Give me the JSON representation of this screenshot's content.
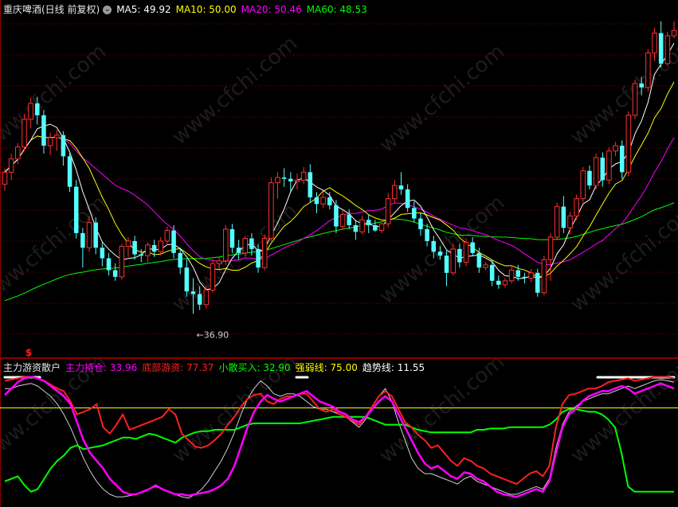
{
  "price_panel": {
    "title": "重庆啤酒(日线 前复权)",
    "dropdown_icon": "chevron-down-icon",
    "indicators": [
      {
        "label": "MA5: 49.92",
        "color": "#ffffff"
      },
      {
        "label": "MA10: 50.00",
        "color": "#ffff00"
      },
      {
        "label": "MA20: 50.46",
        "color": "#ff00ff"
      },
      {
        "label": "MA60: 48.53",
        "color": "#00ff00"
      }
    ],
    "low_marker": "36.90",
    "signal_marker": "$"
  },
  "indicator_panel": {
    "title": "主力游资散户",
    "indicators": [
      {
        "label": "主力持仓: 33.96",
        "color": "#ff00ff"
      },
      {
        "label": "底部游资: 77.37",
        "color": "#ff2020"
      },
      {
        "label": "小散买入: 32.90",
        "color": "#00ff00"
      },
      {
        "label": "强弱线: 75.00",
        "color": "#ffff00"
      },
      {
        "label": "趋势线: 11.55",
        "color": "#ffffff"
      }
    ]
  },
  "watermark": "www.cfchi.com",
  "colors": {
    "up": "#ff3030",
    "down": "#54ffff",
    "grid": "#8b0000",
    "background": "#000000"
  },
  "chart_data": [
    {
      "type": "candlestick",
      "name": "price",
      "ylim": [
        35,
        60
      ],
      "candles": [
        [
          47.3,
          48.5,
          46.8,
          48.2
        ],
        [
          48.2,
          49.6,
          47.6,
          49.2
        ],
        [
          49.2,
          50.4,
          48.8,
          50.1
        ],
        [
          50.1,
          52.6,
          49.8,
          52.2
        ],
        [
          52.2,
          53.8,
          51.5,
          53.4
        ],
        [
          53.4,
          53.9,
          51.8,
          52.5
        ],
        [
          52.5,
          52.9,
          49.6,
          50.2
        ],
        [
          50.2,
          51.2,
          49.5,
          50.8
        ],
        [
          50.8,
          51.4,
          49.8,
          51.0
        ],
        [
          51.0,
          51.3,
          48.7,
          49.4
        ],
        [
          49.4,
          49.8,
          46.7,
          47.1
        ],
        [
          47.1,
          47.6,
          43.2,
          43.6
        ],
        [
          43.6,
          44.0,
          41.0,
          42.5
        ],
        [
          42.5,
          44.9,
          42.2,
          44.4
        ],
        [
          44.4,
          44.8,
          42.0,
          42.5
        ],
        [
          42.5,
          42.9,
          41.1,
          41.7
        ],
        [
          41.7,
          42.1,
          40.4,
          40.8
        ],
        [
          40.8,
          41.3,
          40.0,
          40.3
        ],
        [
          40.3,
          42.8,
          40.1,
          42.6
        ],
        [
          42.6,
          43.3,
          41.8,
          43.0
        ],
        [
          43.0,
          43.4,
          41.6,
          42.0
        ],
        [
          42.0,
          42.4,
          41.4,
          41.9
        ],
        [
          41.9,
          42.9,
          41.4,
          42.7
        ],
        [
          42.7,
          43.1,
          41.8,
          42.2
        ],
        [
          42.2,
          43.3,
          41.9,
          43.0
        ],
        [
          43.0,
          44.1,
          42.7,
          43.8
        ],
        [
          43.8,
          44.2,
          41.7,
          42.1
        ],
        [
          42.1,
          42.5,
          40.5,
          41.0
        ],
        [
          41.0,
          41.6,
          38.8,
          39.2
        ],
        [
          39.2,
          40.2,
          37.5,
          39.0
        ],
        [
          39.0,
          39.6,
          37.8,
          38.2
        ],
        [
          38.2,
          39.6,
          37.9,
          39.3
        ],
        [
          39.3,
          41.6,
          39.1,
          41.3
        ],
        [
          41.3,
          41.8,
          40.9,
          41.5
        ],
        [
          41.5,
          44.2,
          41.2,
          43.9
        ],
        [
          43.9,
          44.3,
          42.1,
          42.5
        ],
        [
          42.5,
          43.1,
          41.6,
          42.1
        ],
        [
          42.1,
          43.4,
          41.8,
          43.2
        ],
        [
          43.2,
          43.6,
          41.9,
          42.4
        ],
        [
          42.4,
          42.8,
          40.6,
          41.0
        ],
        [
          41.0,
          43.5,
          40.8,
          43.2
        ],
        [
          43.2,
          47.8,
          43.0,
          47.4
        ],
        [
          47.4,
          48.2,
          46.2,
          47.8
        ],
        [
          47.8,
          48.5,
          47.1,
          47.7
        ],
        [
          47.7,
          48.2,
          46.7,
          47.5
        ],
        [
          47.5,
          48.1,
          46.9,
          47.6
        ],
        [
          47.6,
          48.6,
          47.3,
          48.2
        ],
        [
          48.2,
          48.8,
          45.9,
          46.3
        ],
        [
          46.3,
          46.7,
          45.1,
          45.8
        ],
        [
          45.8,
          46.7,
          45.5,
          46.3
        ],
        [
          46.3,
          46.7,
          45.4,
          45.7
        ],
        [
          45.7,
          46.1,
          43.6,
          44.1
        ],
        [
          44.1,
          45.3,
          43.9,
          45.0
        ],
        [
          45.0,
          45.4,
          43.9,
          44.2
        ],
        [
          44.2,
          44.6,
          43.1,
          43.7
        ],
        [
          43.7,
          44.9,
          43.5,
          44.6
        ],
        [
          44.6,
          45.0,
          43.6,
          44.2
        ],
        [
          44.2,
          44.6,
          43.7,
          43.8
        ],
        [
          43.8,
          44.5,
          43.6,
          44.3
        ],
        [
          44.3,
          46.6,
          44.0,
          46.2
        ],
        [
          46.2,
          47.6,
          45.9,
          47.2
        ],
        [
          47.2,
          48.2,
          46.5,
          46.9
        ],
        [
          46.9,
          47.3,
          45.2,
          45.5
        ],
        [
          45.5,
          46.0,
          44.4,
          44.7
        ],
        [
          44.7,
          45.1,
          43.4,
          43.9
        ],
        [
          43.9,
          44.3,
          42.6,
          43.0
        ],
        [
          43.0,
          43.4,
          41.7,
          42.2
        ],
        [
          42.2,
          42.6,
          41.6,
          41.9
        ],
        [
          41.9,
          42.3,
          39.6,
          40.6
        ],
        [
          40.6,
          42.8,
          40.4,
          42.4
        ],
        [
          42.4,
          42.8,
          41.0,
          41.4
        ],
        [
          41.4,
          43.2,
          41.1,
          42.9
        ],
        [
          42.9,
          43.3,
          41.9,
          42.1
        ],
        [
          42.1,
          42.5,
          40.6,
          41.0
        ],
        [
          41.0,
          41.4,
          40.8,
          41.2
        ],
        [
          41.2,
          41.6,
          39.6,
          40.0
        ],
        [
          40.0,
          40.4,
          39.4,
          39.7
        ],
        [
          39.7,
          40.2,
          39.5,
          40.0
        ],
        [
          40.0,
          41.2,
          39.8,
          40.8
        ],
        [
          40.8,
          41.2,
          40.0,
          40.3
        ],
        [
          40.3,
          40.6,
          39.8,
          40.2
        ],
        [
          40.2,
          40.9,
          39.9,
          40.6
        ],
        [
          40.6,
          40.9,
          38.8,
          39.1
        ],
        [
          39.1,
          41.9,
          38.9,
          41.6
        ],
        [
          41.6,
          43.6,
          40.0,
          43.3
        ],
        [
          43.3,
          45.9,
          43.1,
          45.6
        ],
        [
          45.6,
          46.4,
          43.6,
          44.0
        ],
        [
          44.0,
          45.2,
          43.5,
          44.9
        ],
        [
          44.9,
          46.5,
          44.6,
          46.2
        ],
        [
          46.2,
          48.6,
          45.9,
          48.3
        ],
        [
          48.3,
          48.7,
          46.9,
          47.2
        ],
        [
          47.2,
          49.6,
          46.9,
          49.3
        ],
        [
          49.3,
          49.7,
          47.1,
          47.6
        ],
        [
          47.6,
          50.1,
          47.3,
          49.8
        ],
        [
          49.8,
          50.5,
          49.4,
          50.2
        ],
        [
          50.2,
          50.6,
          47.7,
          48.2
        ],
        [
          48.2,
          52.8,
          47.9,
          52.5
        ],
        [
          52.5,
          55.2,
          52.2,
          54.9
        ],
        [
          54.9,
          55.4,
          54.0,
          54.6
        ],
        [
          54.6,
          57.5,
          54.3,
          57.2
        ],
        [
          57.2,
          59.1,
          56.6,
          58.7
        ],
        [
          58.7,
          59.6,
          56.1,
          56.4
        ],
        [
          56.4,
          58.8,
          56.2,
          58.5
        ],
        [
          58.5,
          59.6,
          58.3,
          58.9
        ]
      ],
      "low_label_value": 36.9
    },
    {
      "type": "line",
      "name": "indicator",
      "ylim": [
        0,
        100
      ],
      "reference_line": 75.0,
      "series": [
        {
          "name": "主力持仓",
          "color": "#ff00ff",
          "values": [
            85,
            90,
            95,
            98,
            99,
            98,
            96,
            92,
            88,
            84,
            78,
            64,
            50,
            40,
            34,
            28,
            20,
            15,
            10,
            8,
            8,
            10,
            12,
            15,
            12,
            10,
            8,
            8,
            7,
            8,
            9,
            10,
            12,
            15,
            20,
            30,
            45,
            60,
            72,
            80,
            85,
            82,
            80,
            82,
            84,
            86,
            88,
            84,
            80,
            78,
            76,
            72,
            70,
            66,
            64,
            68,
            74,
            80,
            84,
            80,
            70,
            60,
            50,
            40,
            32,
            28,
            30,
            26,
            22,
            20,
            25,
            24,
            20,
            18,
            14,
            10,
            8,
            7,
            6,
            8,
            10,
            12,
            10,
            18,
            40,
            60,
            70,
            74,
            80,
            84,
            86,
            88,
            88,
            90,
            92,
            90,
            86,
            88,
            90,
            92,
            94,
            92,
            90
          ]
        },
        {
          "name": "底部游资",
          "color": "#ff2020",
          "values": [
            96,
            97,
            98,
            99,
            99,
            98,
            96,
            93,
            90,
            88,
            80,
            70,
            72,
            74,
            78,
            60,
            55,
            62,
            70,
            58,
            60,
            62,
            64,
            66,
            68,
            74,
            70,
            55,
            50,
            45,
            44,
            46,
            50,
            55,
            62,
            68,
            76,
            82,
            85,
            86,
            80,
            78,
            82,
            84,
            84,
            86,
            86,
            80,
            74,
            72,
            74,
            70,
            68,
            65,
            62,
            68,
            76,
            84,
            88,
            84,
            74,
            64,
            60,
            54,
            50,
            44,
            46,
            40,
            34,
            30,
            36,
            34,
            30,
            28,
            24,
            22,
            20,
            18,
            16,
            20,
            24,
            26,
            22,
            30,
            60,
            78,
            85,
            86,
            88,
            90,
            90,
            92,
            95,
            96,
            97,
            98,
            96,
            97,
            98,
            99,
            99,
            99,
            98
          ]
        },
        {
          "name": "小散买入",
          "color": "#00ff00",
          "values": [
            18,
            20,
            22,
            15,
            10,
            12,
            20,
            28,
            34,
            38,
            44,
            46,
            43,
            44,
            45,
            46,
            48,
            50,
            52,
            52,
            51,
            53,
            55,
            54,
            52,
            50,
            48,
            52,
            54,
            56,
            57,
            57,
            58,
            58,
            58,
            58,
            60,
            62,
            63,
            63,
            63,
            63,
            63,
            63,
            63,
            63,
            64,
            65,
            66,
            67,
            68,
            68,
            68,
            68,
            68,
            68,
            66,
            64,
            62,
            62,
            62,
            62,
            60,
            58,
            57,
            56,
            56,
            56,
            56,
            56,
            56,
            56,
            58,
            58,
            59,
            59,
            59,
            60,
            60,
            60,
            60,
            60,
            60,
            62,
            66,
            72,
            74,
            74,
            73,
            72,
            72,
            70,
            66,
            60,
            40,
            14,
            10,
            10,
            10,
            10,
            10,
            10,
            10
          ]
        },
        {
          "name": "趋势线",
          "color": "#d0d0d0",
          "values": [
            90,
            90,
            92,
            93,
            94,
            92,
            88,
            84,
            78,
            70,
            60,
            48,
            36,
            26,
            18,
            12,
            8,
            6,
            6,
            7,
            8,
            10,
            12,
            14,
            12,
            10,
            8,
            6,
            5,
            8,
            12,
            18,
            26,
            34,
            44,
            56,
            70,
            82,
            90,
            96,
            92,
            86,
            84,
            86,
            86,
            84,
            80,
            76,
            74,
            74,
            72,
            70,
            68,
            64,
            60,
            66,
            76,
            84,
            90,
            80,
            64,
            50,
            36,
            28,
            24,
            24,
            22,
            20,
            18,
            16,
            20,
            22,
            18,
            16,
            14,
            12,
            10,
            8,
            8,
            10,
            12,
            14,
            12,
            20,
            44,
            62,
            72,
            76,
            80,
            82,
            84,
            86,
            86,
            88,
            90,
            92,
            90,
            92,
            94,
            96,
            97,
            96,
            95
          ]
        }
      ]
    }
  ]
}
